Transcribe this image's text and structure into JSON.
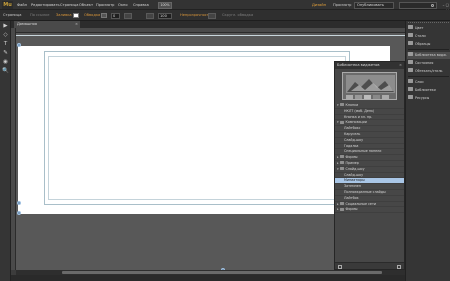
{
  "app": {
    "logo": "Mu"
  },
  "menubar": {
    "items": [
      "Файл",
      "Редактировать",
      "Страница",
      "Объект",
      "Просмотр",
      "Окно",
      "Справка"
    ],
    "zoom": "100%",
    "workspaces": [
      "Дизайн",
      "Просмотр"
    ],
    "active_workspace": "Дизайн",
    "workspace_dropdown": "Опубликовать",
    "window_controls": "– ▢ ✕"
  },
  "controlbar": {
    "items": [
      {
        "label": "Страница",
        "dim": false
      },
      {
        "label": "По ссылке",
        "dim": true
      },
      {
        "label": "Заливка",
        "dim": false,
        "accent": true
      },
      {
        "label": "Обводка",
        "dim": false,
        "accent": true
      },
      {
        "label": "Непрозрачность",
        "dim": false,
        "accent": true
      },
      {
        "label": "Скругл. обводка",
        "dim": true
      }
    ],
    "fields": [
      "0",
      "100"
    ]
  },
  "document": {
    "tab_label": "Домашняя",
    "tab_close": "×"
  },
  "tools": [
    "▶",
    "◇",
    "T",
    "✎",
    "◉",
    "🔍"
  ],
  "library": {
    "title": "Библиотека виджетов",
    "close": "×",
    "items": [
      {
        "label": "Кнопки",
        "level": 0,
        "arrow": "▾",
        "folder": true
      },
      {
        "label": "НКЛТ (моб. Денк)",
        "level": 1
      },
      {
        "label": "Кнопка и эл. пр.",
        "level": 1
      },
      {
        "label": "Композиции",
        "level": 0,
        "arrow": "▾",
        "folder": true
      },
      {
        "label": "Лайтбокс",
        "level": 1
      },
      {
        "label": "Карусель",
        "level": 1
      },
      {
        "label": "Слайд-шоу",
        "level": 1
      },
      {
        "label": "Гадалка",
        "level": 1
      },
      {
        "label": "Специальные панели",
        "level": 1
      },
      {
        "label": "Формы",
        "level": 0,
        "arrow": "▸",
        "folder": true
      },
      {
        "label": "Пример",
        "level": 0,
        "arrow": "▸",
        "folder": true
      },
      {
        "label": "Слайд-шоу",
        "level": 0,
        "arrow": "▾",
        "folder": true
      },
      {
        "label": "Слайд-шоу",
        "level": 1
      },
      {
        "label": "Миниатюры",
        "level": 1,
        "selected": true
      },
      {
        "label": "Затемнен",
        "level": 1
      },
      {
        "label": "Полноэкранные слайды",
        "level": 1
      },
      {
        "label": "Лайтбок",
        "level": 1
      },
      {
        "label": "Социальные сети",
        "level": 0,
        "arrow": "▸",
        "folder": true
      },
      {
        "label": "Формы",
        "level": 0,
        "arrow": "▸",
        "folder": true
      }
    ]
  },
  "dock": {
    "items": [
      {
        "label": "Цвет",
        "icon": "color-icon"
      },
      {
        "label": "Стили",
        "icon": "styles-icon"
      },
      {
        "label": "Образцы",
        "icon": "swatches-icon"
      },
      {
        "label": "Библиотека видж.",
        "icon": "widgets-icon",
        "active": true
      },
      {
        "label": "Состояния",
        "icon": "states-icon"
      },
      {
        "label": "Обтекать/стиль",
        "icon": "wrap-icon"
      },
      {
        "label": "Слои",
        "icon": "layers-icon"
      },
      {
        "label": "Библиотеки",
        "icon": "libraries-icon"
      },
      {
        "label": "Ресурсы",
        "icon": "assets-icon"
      }
    ]
  },
  "colors": {
    "accent": "#e8a33a",
    "selection": "#a9c6e6",
    "guide": "#a9bfc9"
  }
}
